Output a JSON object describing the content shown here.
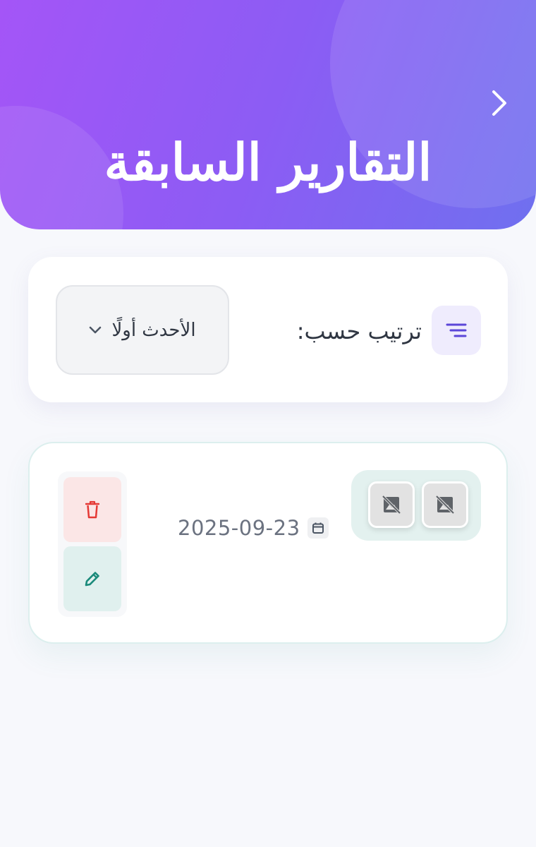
{
  "header": {
    "title": "التقارير السابقة",
    "back_icon": "chevron-right-icon",
    "gradient_start": "#a455f7",
    "gradient_end": "#6f70ef"
  },
  "sort": {
    "icon": "sort-lines-icon",
    "label": "ترتيب حسب:",
    "selected_option": "الأحدث أولًا",
    "dropdown_icon": "chevron-down-icon"
  },
  "reports": [
    {
      "date": "2025-09-23",
      "date_icon": "calendar-icon",
      "images": [
        {
          "icon": "image-unavailable-icon"
        },
        {
          "icon": "image-unavailable-icon"
        }
      ],
      "delete_icon": "trash-icon",
      "edit_icon": "pencil-icon",
      "delete_color": "#e53935",
      "edit_color": "#1a8a7a"
    }
  ]
}
